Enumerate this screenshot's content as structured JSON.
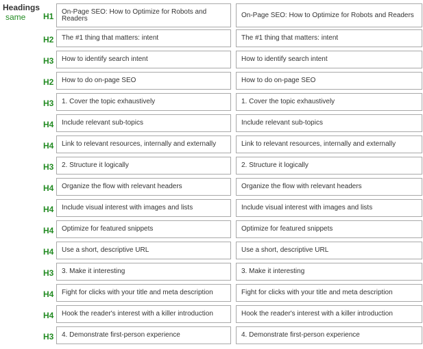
{
  "section": {
    "title": "Headings",
    "status": "same",
    "status_color": "#228b22"
  },
  "rows": [
    {
      "level": "H1",
      "current": "On-Page SEO: How to Optimize for Robots and Readers",
      "compare": "On-Page SEO: How to Optimize for Robots and Readers"
    },
    {
      "level": "H2",
      "current": "The #1 thing that matters: intent",
      "compare": "The #1 thing that matters: intent"
    },
    {
      "level": "H3",
      "current": "How to identify search intent",
      "compare": "How to identify search intent"
    },
    {
      "level": "H2",
      "current": "How to do on-page SEO",
      "compare": "How to do on-page SEO"
    },
    {
      "level": "H3",
      "current": "1. Cover the topic exhaustively",
      "compare": "1. Cover the topic exhaustively"
    },
    {
      "level": "H4",
      "current": "Include relevant sub-topics",
      "compare": "Include relevant sub-topics"
    },
    {
      "level": "H4",
      "current": "Link to relevant resources, internally and externally",
      "compare": "Link to relevant resources, internally and externally"
    },
    {
      "level": "H3",
      "current": "2. Structure it logically",
      "compare": "2. Structure it logically"
    },
    {
      "level": "H4",
      "current": "Organize the flow with relevant headers",
      "compare": "Organize the flow with relevant headers"
    },
    {
      "level": "H4",
      "current": "Include visual interest with images and lists",
      "compare": "Include visual interest with images and lists"
    },
    {
      "level": "H4",
      "current": "Optimize for featured snippets",
      "compare": "Optimize for featured snippets"
    },
    {
      "level": "H4",
      "current": "Use a short, descriptive URL",
      "compare": "Use a short, descriptive URL"
    },
    {
      "level": "H3",
      "current": "3. Make it interesting",
      "compare": "3. Make it interesting"
    },
    {
      "level": "H4",
      "current": "Fight for clicks with your title and meta description",
      "compare": "Fight for clicks with your title and meta description"
    },
    {
      "level": "H4",
      "current": "Hook the reader's interest with a killer introduction",
      "compare": "Hook the reader's interest with a killer introduction"
    },
    {
      "level": "H3",
      "current": "4. Demonstrate first-person experience",
      "compare": "4. Demonstrate first-person experience"
    }
  ]
}
